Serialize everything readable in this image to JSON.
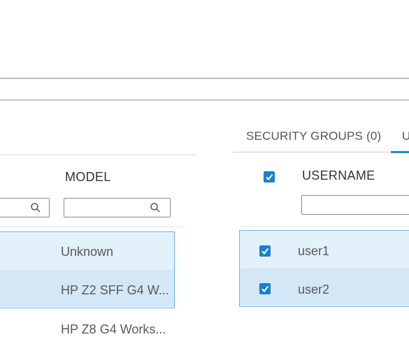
{
  "left_table": {
    "model_header": "MODEL",
    "model_search": {
      "value": "",
      "placeholder": ""
    },
    "prev_search": {
      "value": "",
      "placeholder": ""
    },
    "rows": [
      {
        "model": "Unknown",
        "selected": true
      },
      {
        "model": "HP Z2 SFF G4 W...",
        "selected": true
      },
      {
        "model": "HP Z8 G4 Works...",
        "selected": false
      }
    ]
  },
  "right_panel": {
    "tabs": [
      {
        "label": "SECURITY GROUPS (0)",
        "active": false
      },
      {
        "label": "U",
        "active": true
      }
    ],
    "username_header": "USERNAME",
    "username_search": {
      "value": "",
      "placeholder": ""
    },
    "select_all_checked": true,
    "rows": [
      {
        "username": "user1",
        "checked": true
      },
      {
        "username": "user2",
        "checked": true
      }
    ]
  },
  "colors": {
    "accent": "#1a7fcf",
    "selection_border": "#6fb3e0",
    "selection_fill_light": "#e3f1fb",
    "selection_fill_dark": "#d3e7f6"
  }
}
